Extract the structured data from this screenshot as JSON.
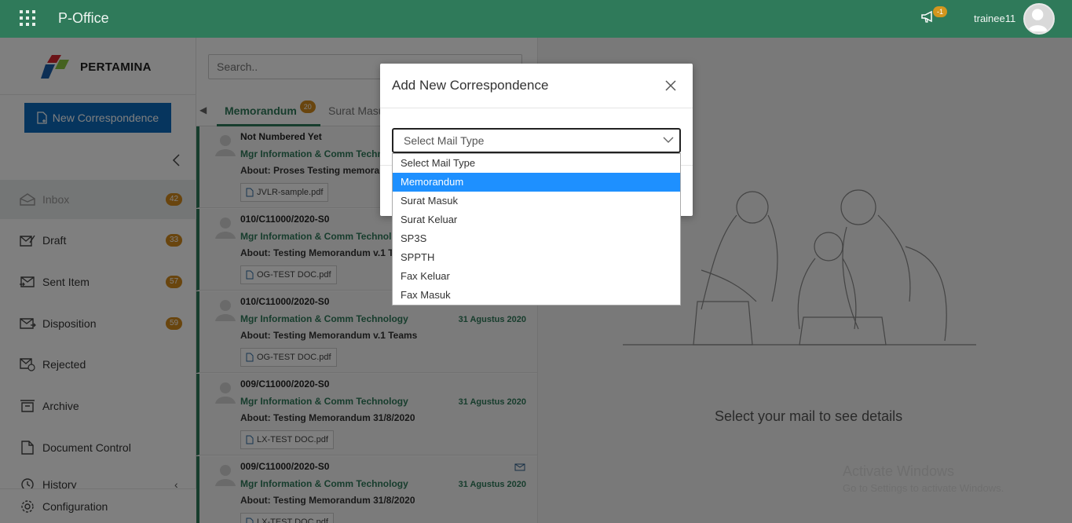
{
  "topbar": {
    "app_title": "P-Office",
    "notif_count": "-1",
    "username": "trainee11"
  },
  "sidebar": {
    "logo_text": "PERTAMINA",
    "new_button": "New Correspondence",
    "items": [
      {
        "label": "Inbox",
        "badge": "42"
      },
      {
        "label": "Draft",
        "badge": "33"
      },
      {
        "label": "Sent Item",
        "badge": "57"
      },
      {
        "label": "Disposition",
        "badge": "59"
      },
      {
        "label": "Rejected"
      },
      {
        "label": "Archive"
      },
      {
        "label": "Document Control"
      },
      {
        "label": "History"
      },
      {
        "label": "Configuration"
      }
    ]
  },
  "list": {
    "search_placeholder": "Search..",
    "tabs": [
      {
        "label": "Memorandum",
        "badge": "20"
      },
      {
        "label": "Surat Masu"
      }
    ],
    "mails": [
      {
        "number": "Not Numbered Yet",
        "from": "Mgr Information & Comm Techn",
        "about": "About: Proses Testing memorand",
        "attachment": "JVLR-sample.pdf",
        "date": ""
      },
      {
        "number": "010/C11000/2020-S0",
        "from": "Mgr Information & Comm Technol",
        "about": "About: Testing Memorandum v.1 T",
        "attachment": "OG-TEST DOC.pdf",
        "date": ""
      },
      {
        "number": "010/C11000/2020-S0",
        "from": "Mgr Information & Comm Technology",
        "about": "About: Testing Memorandum v.1 Teams",
        "attachment": "OG-TEST DOC.pdf",
        "date": "31 Agustus 2020"
      },
      {
        "number": "009/C11000/2020-S0",
        "from": "Mgr Information & Comm Technology",
        "about": "About: Testing Memorandum 31/8/2020",
        "attachment": "LX-TEST DOC.pdf",
        "date": "31 Agustus 2020"
      },
      {
        "number": "009/C11000/2020-S0",
        "from": "Mgr Information & Comm Technology",
        "about": "About: Testing Memorandum 31/8/2020",
        "attachment": "LX-TEST DOC.pdf",
        "date": "31 Agustus 2020"
      }
    ]
  },
  "detail": {
    "message": "Select your mail to see details",
    "watermark_title": "Activate Windows",
    "watermark_sub": "Go to Settings to activate Windows."
  },
  "modal": {
    "title": "Add New Correspondence",
    "select_value": "Select Mail Type",
    "options": [
      "Select Mail Type",
      "Memorandum",
      "Surat Masuk",
      "Surat Keluar",
      "SP3S",
      "SPPTH",
      "Fax Keluar",
      "Fax Masuk"
    ],
    "highlighted": "Memorandum"
  },
  "colors": {
    "brand": "#2f7a5a",
    "button": "#0c6bbd",
    "badge": "#d38a1c",
    "highlight": "#1e90ff"
  }
}
